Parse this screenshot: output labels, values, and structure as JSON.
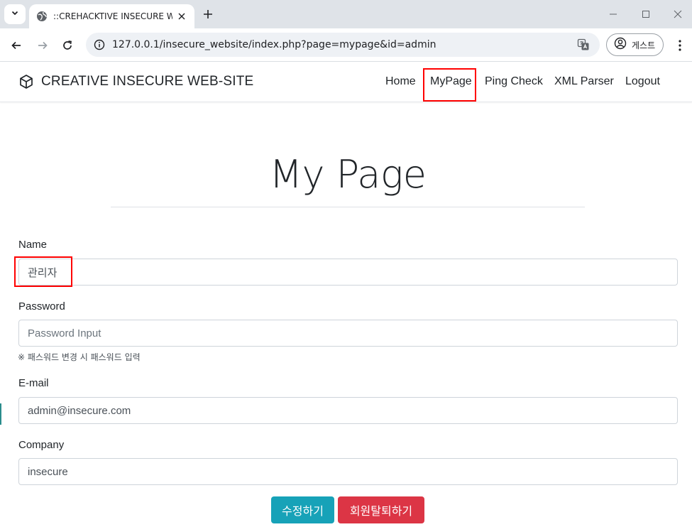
{
  "browser": {
    "tab_title": "::CREHACKTIVE INSECURE WEB",
    "url": "127.0.0.1/insecure_website/index.php?page=mypage&id=admin",
    "profile_label": "게스트"
  },
  "navbar": {
    "brand": "CREATIVE INSECURE WEB-SITE",
    "links": [
      "Home",
      "MyPage",
      "Ping Check",
      "XML Parser",
      "Logout"
    ],
    "active": "MyPage"
  },
  "page": {
    "title": "My Page"
  },
  "form": {
    "name_label": "Name",
    "name_value": "관리자",
    "password_label": "Password",
    "password_placeholder": "Password Input",
    "password_help": "※ 패스워드 변경 시 패스워드 입력",
    "email_label": "E-mail",
    "email_value": "admin@insecure.com",
    "company_label": "Company",
    "company_value": "insecure",
    "update_button": "수정하기",
    "withdraw_button": "회원탈퇴하기"
  },
  "colors": {
    "highlight": "#ff0000",
    "info": "#17a2b8",
    "danger": "#dc3545"
  }
}
